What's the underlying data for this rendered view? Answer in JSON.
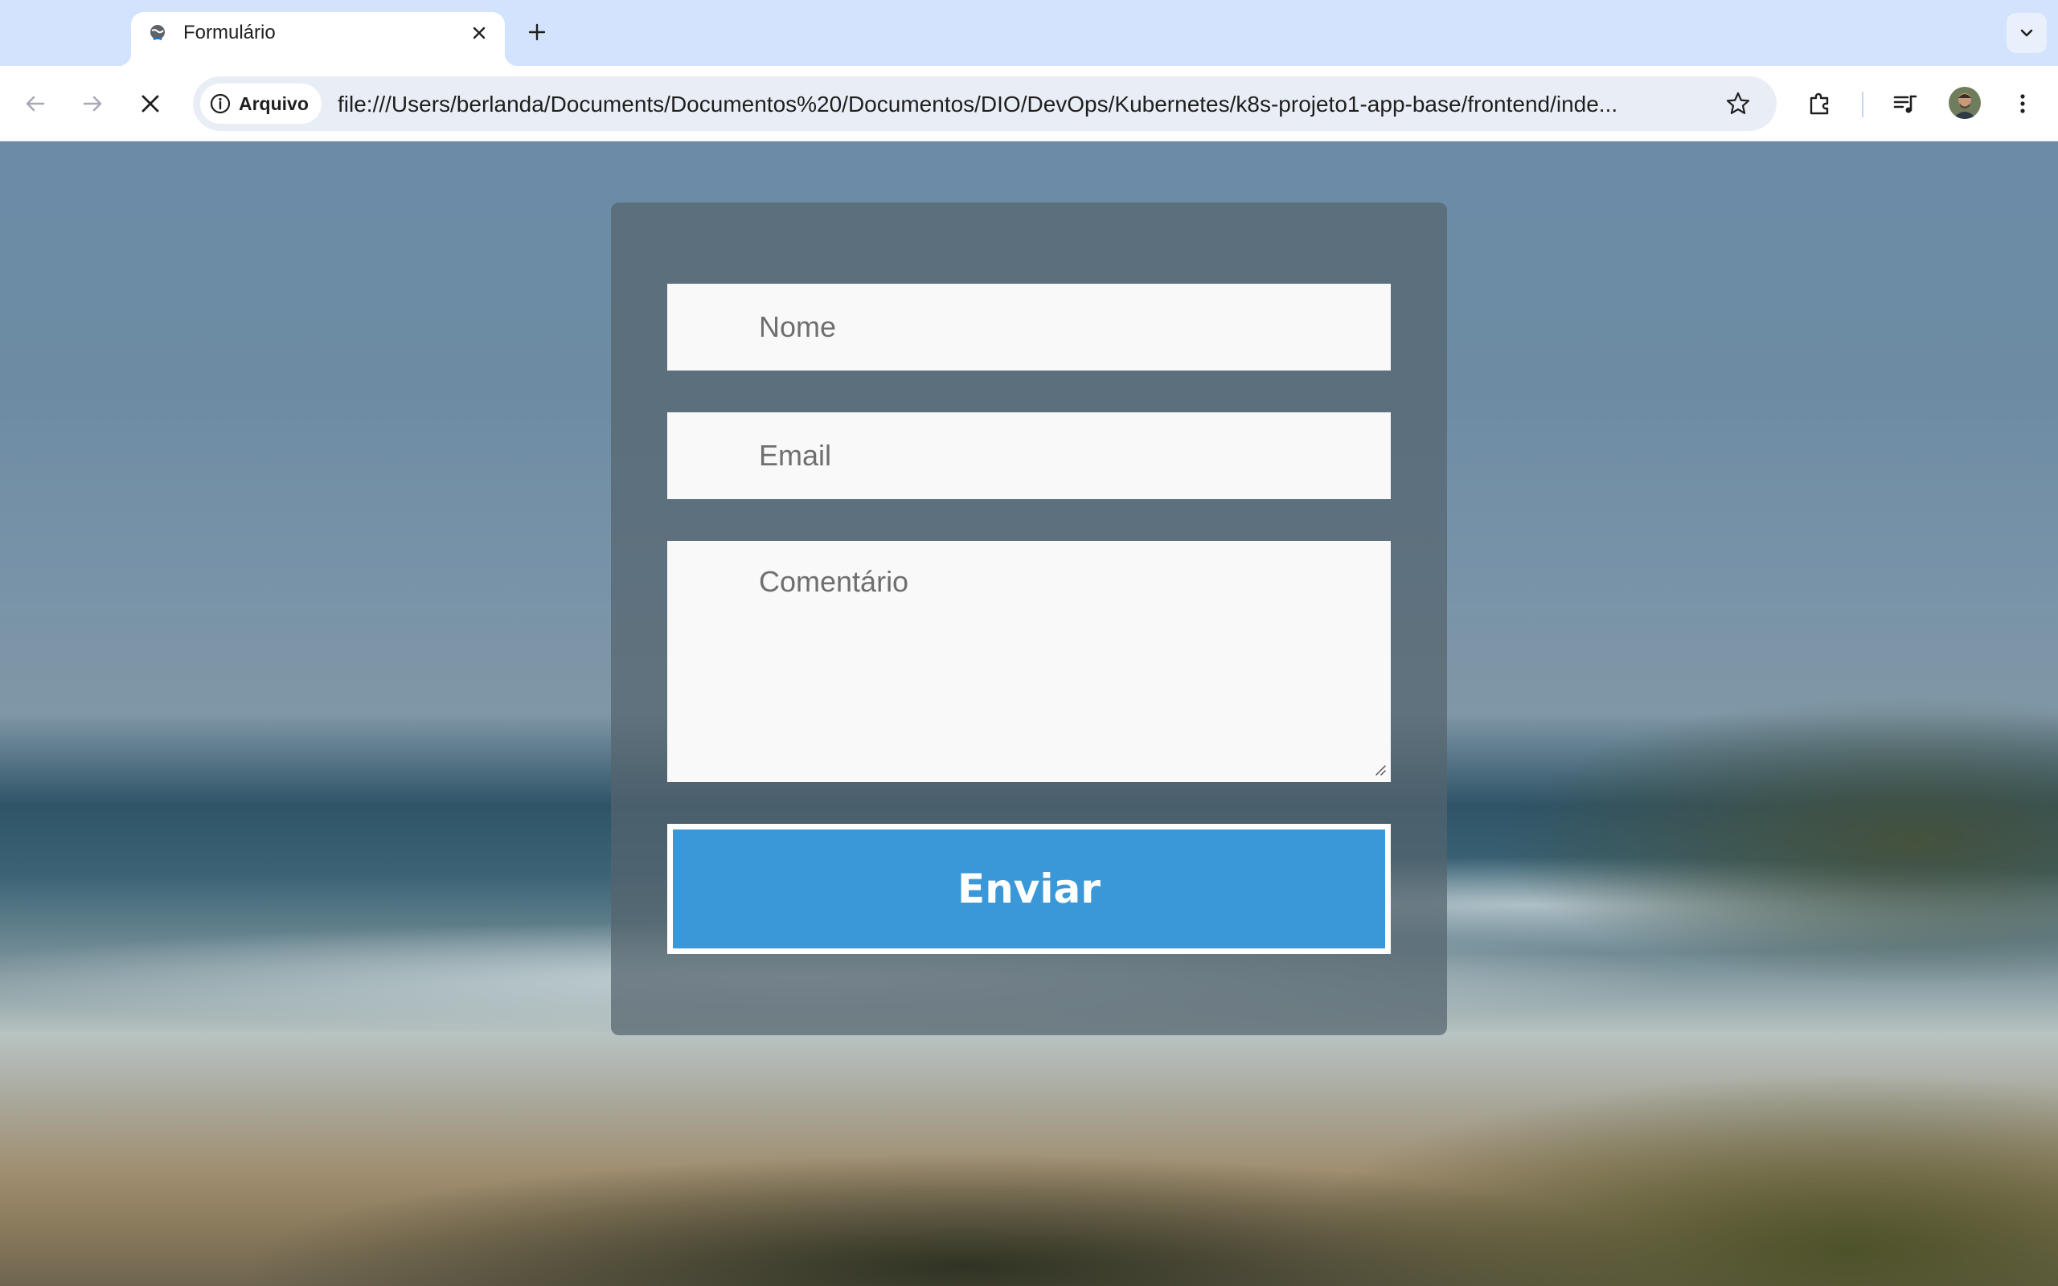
{
  "browser": {
    "tab": {
      "title": "Formulário",
      "favicon": "globe-favicon-icon",
      "close_icon": "close-icon"
    },
    "new_tab_icon": "plus-icon",
    "tab_search_icon": "chevron-down-icon",
    "toolbar": {
      "back_icon": "arrow-left-icon",
      "forward_icon": "arrow-right-icon",
      "stop_icon": "close-icon",
      "site_info_label": "Arquivo",
      "url": "file:///Users/berlanda/Documents/Documentos%20/Documentos/DIO/DevOps/Kubernetes/k8s-projeto1-app-base/frontend/inde...",
      "bookmark_icon": "star-icon",
      "extensions_icon": "puzzle-icon",
      "media_icon": "queue-music-icon",
      "avatar_icon": "profile-avatar",
      "menu_icon": "kebab-menu-icon"
    }
  },
  "form": {
    "name_placeholder": "Nome",
    "email_placeholder": "Email",
    "comment_placeholder": "Comentário",
    "submit_label": "Enviar"
  },
  "colors": {
    "tab_strip": "#d3e3fd",
    "omnibox": "#e9eef6",
    "submit_button": "#3b98d8",
    "card_overlay": "#55646e"
  }
}
